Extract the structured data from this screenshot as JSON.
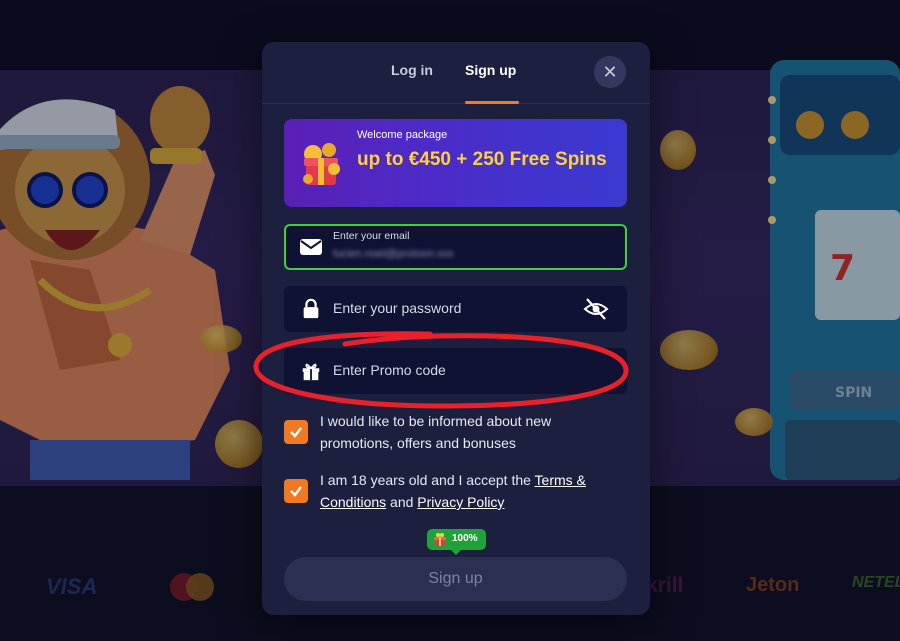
{
  "tabs": {
    "login": "Log in",
    "signup": "Sign up",
    "active": "signup"
  },
  "close": {
    "glyph": "✕"
  },
  "welcome": {
    "label": "Welcome package",
    "offer": "up to €450 + 250 Free Spins"
  },
  "form": {
    "email": {
      "label": "Enter your email",
      "value": "lucien.noel@protoon.xxx",
      "state": "valid"
    },
    "password": {
      "placeholder": "Enter your password",
      "visibility_icon": "eye-off-icon"
    },
    "promo": {
      "placeholder": "Enter Promo code"
    }
  },
  "consents": {
    "marketing": {
      "text": "I would like to be informed about new promotions, offers and bonuses",
      "checked": true
    },
    "age": {
      "prefix": "I am 18 years old and I accept the ",
      "terms_link": "Terms & Conditions",
      "middle": " and ",
      "privacy_link": "Privacy Policy",
      "checked": true
    }
  },
  "bonus_badge": {
    "text": "100%"
  },
  "submit": {
    "label": "Sign up"
  },
  "payment_logos": [
    "VISA",
    "Mastercard",
    "Skrill",
    "Jeton",
    "NETELLER"
  ],
  "colors": {
    "accent": "#f27a2c",
    "valid_border": "#3dd13d",
    "highlight_annotation": "#e8212a",
    "banner_text": "#ffd23a",
    "badge": "#1fa23a"
  }
}
